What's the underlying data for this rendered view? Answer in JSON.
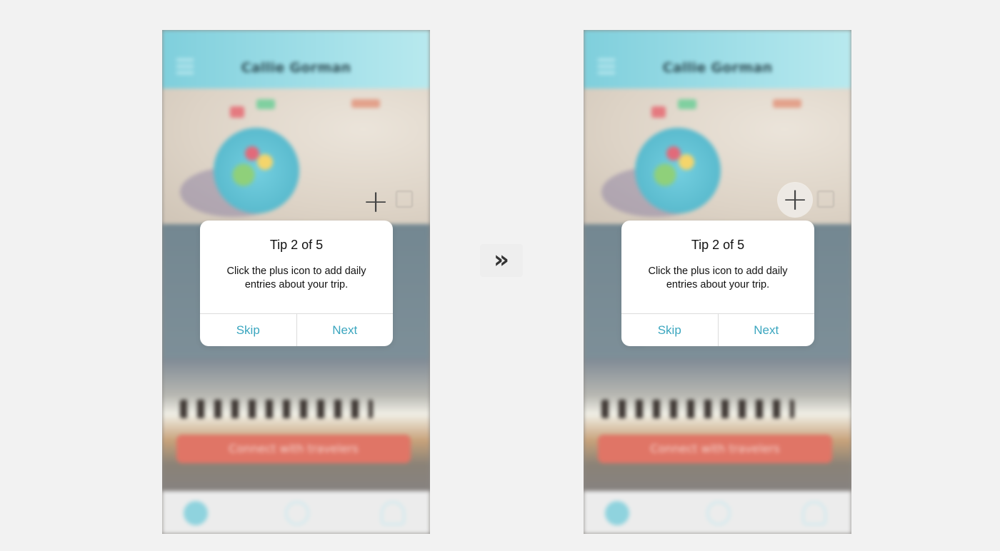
{
  "screens": [
    {
      "appbar_title": "Callie Gorman",
      "tip": {
        "title": "Tip 2 of 5",
        "body": "Click the plus icon to add daily entries about your trip.",
        "skip_label": "Skip",
        "next_label": "Next"
      },
      "connect_label": "Connect with travelers",
      "plus_highlighted": false
    },
    {
      "appbar_title": "Callie Gorman",
      "tip": {
        "title": "Tip 2 of 5",
        "body": "Click the plus icon to add daily entries about your trip.",
        "skip_label": "Skip",
        "next_label": "Next"
      },
      "connect_label": "Connect with travelers",
      "plus_highlighted": true
    }
  ],
  "transition_icon": "double-chevron-right-icon",
  "colors": {
    "accent": "#3ba6bf",
    "appbar": "#7fcfdc",
    "connect_button": "#e07566",
    "background": "#f2f2f2"
  }
}
